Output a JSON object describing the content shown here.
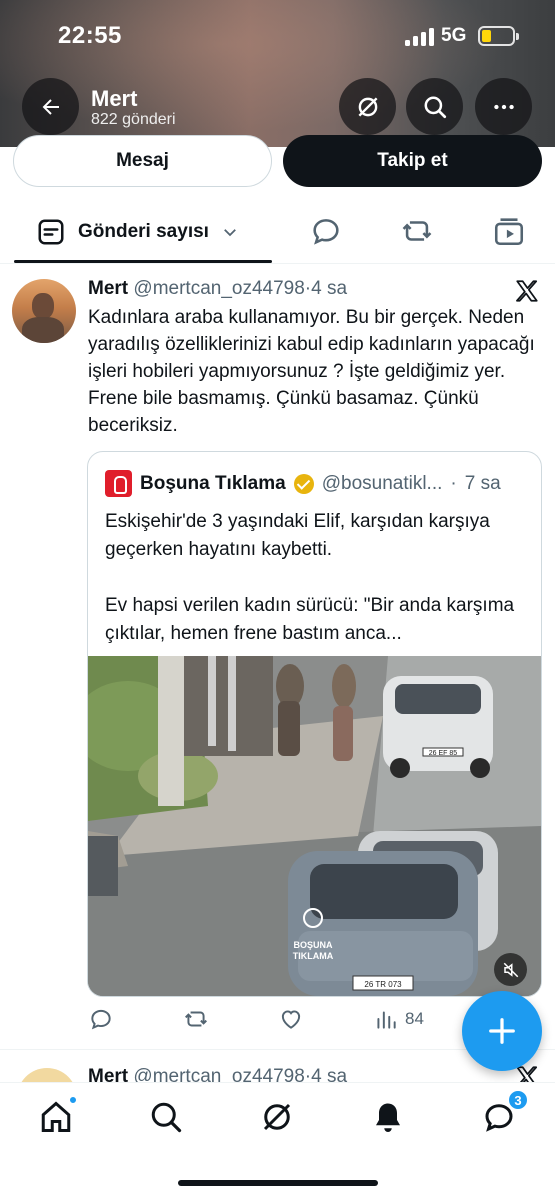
{
  "status_bar": {
    "time": "22:55",
    "network": "5G",
    "battery_color": "#ffd60a"
  },
  "header": {
    "profile_name": "Mert",
    "post_count": "822 gönderi",
    "icons": {
      "back": "back-arrow-icon",
      "grok": "grok-icon",
      "search": "search-icon",
      "more": "more-icon"
    }
  },
  "actions_row": {
    "message_label": "Mesaj",
    "follow_label": "Takip et"
  },
  "filter_bar": {
    "selected": "Gönderi sayısı",
    "icons": [
      "post-count-icon",
      "chevron-down-icon",
      "replies-icon",
      "reposts-icon",
      "videos-icon"
    ]
  },
  "tweet": {
    "author_name": "Mert",
    "handle": "@mertcan_oz44798",
    "separator": "·",
    "time": "4 sa",
    "text": "Kadınlara araba kullanamıyor. Bu bir gerçek. Neden yaradılış özelliklerinizi kabul edip kadınların yapacağı işleri hobileri yapmıyorsunuz ? İşte geldiğimiz yer. Frene bile basmamış. Çünkü basamaz. Çünkü beceriksiz.",
    "quote": {
      "name": "Boşuna Tıklama",
      "handle": "@bosunatikl...",
      "time": "7 sa",
      "text_1": "Eskişehir'de 3 yaşındaki Elif, karşıdan karşıya geçerken hayatını kaybetti.",
      "text_2": "Ev hapsi verilen kadın sürücü: \"Bir anda karşıma çıktılar, hemen frene bastım anca...",
      "watermark_1": "BOŞUNA",
      "watermark_2": "TIKLAMA",
      "plate_1": "26 EF 85",
      "plate_2": "26 TR 073"
    },
    "views": "84",
    "accent_color": "#1d9bf0"
  },
  "next_tweet": {
    "author_name": "Mert",
    "handle": "@mertcan_oz44798",
    "time": "4 sa"
  },
  "bottom_nav": {
    "items": [
      "home-icon",
      "explore-icon",
      "grok-icon",
      "notifications-icon",
      "messages-icon"
    ],
    "messages_badge": "3"
  }
}
